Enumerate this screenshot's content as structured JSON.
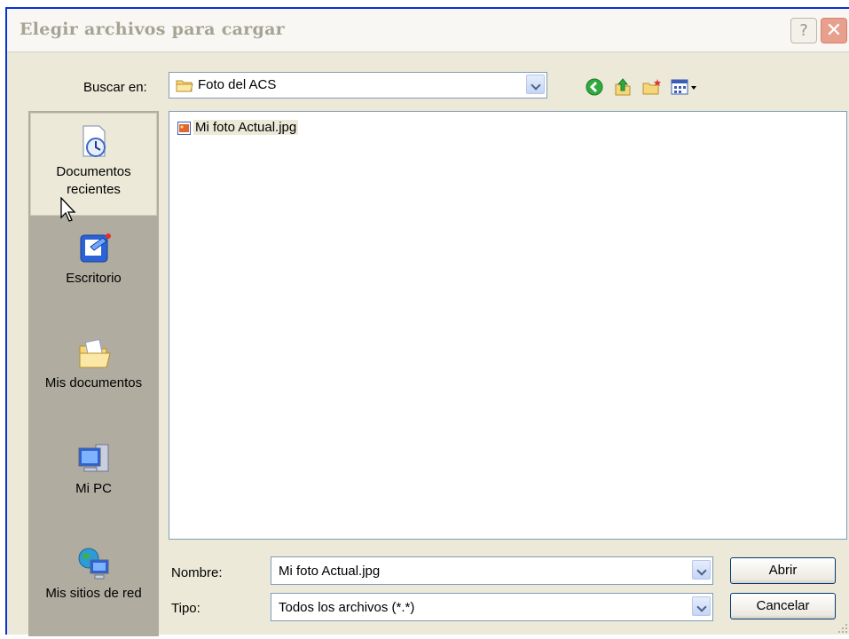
{
  "window": {
    "title": "Elegir archivos para cargar",
    "help_label": "?",
    "close_label": "✕"
  },
  "lookin": {
    "label": "Buscar en:",
    "value": "Foto del ACS"
  },
  "toolbar": {
    "icons": [
      "back-icon",
      "up-folder-icon",
      "new-folder-icon",
      "views-menu-icon"
    ]
  },
  "places": [
    {
      "label_line1": "Documentos",
      "label_line2": "recientes",
      "icon": "recent-documents-icon"
    },
    {
      "label_line1": "Escritorio",
      "icon": "desktop-icon"
    },
    {
      "label_line1": "Mis documentos",
      "icon": "my-documents-icon"
    },
    {
      "label_line1": "Mi PC",
      "icon": "my-computer-icon"
    },
    {
      "label_line1": "Mis sitios de red",
      "icon": "network-places-icon"
    }
  ],
  "files": [
    {
      "name": "Mi foto Actual.jpg",
      "icon": "jpg-file-icon"
    }
  ],
  "filename": {
    "label": "Nombre:",
    "value": "Mi foto Actual.jpg"
  },
  "filetype": {
    "label": "Tipo:",
    "value": "Todos los archivos (*.*)"
  },
  "buttons": {
    "open": "Abrir",
    "cancel": "Cancelar"
  },
  "colors": {
    "title_text": "#a7a394",
    "dialog_bg": "#ece9d8",
    "places_bg": "#b0aca0",
    "input_border": "#7f9db9"
  }
}
